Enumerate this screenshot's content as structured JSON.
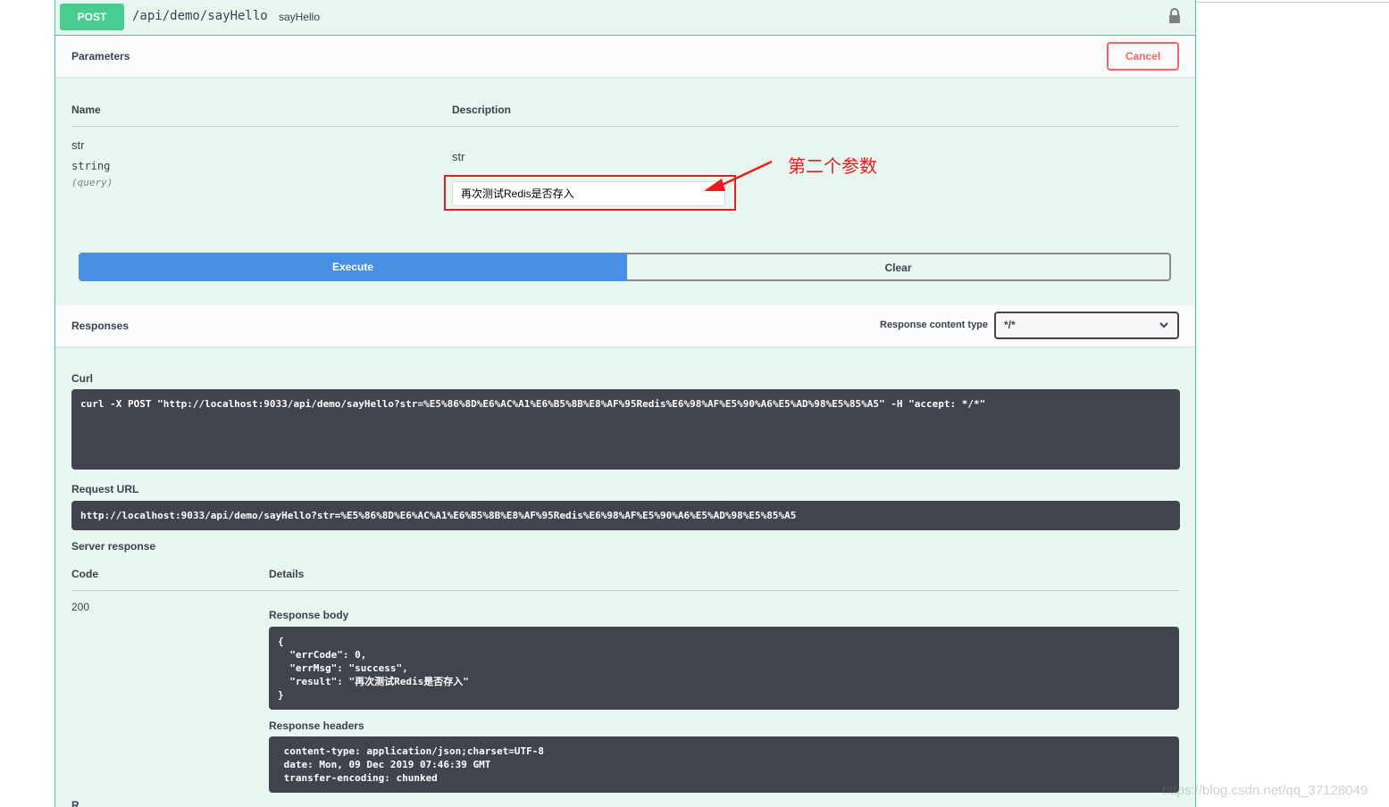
{
  "operation": {
    "method": "POST",
    "path": "/api/demo/sayHello",
    "summary": "sayHello",
    "lock_icon": "lock-icon"
  },
  "parameters": {
    "title": "Parameters",
    "cancel_label": "Cancel",
    "col_name": "Name",
    "col_description": "Description",
    "param": {
      "name": "str",
      "type": "string",
      "in": "(query)",
      "description": "str",
      "value": "再次测试Redis是否存入"
    },
    "annotation": "第二个参数",
    "execute_label": "Execute",
    "clear_label": "Clear"
  },
  "responses": {
    "title": "Responses",
    "content_type_label": "Response content type",
    "content_type_value": "*/*",
    "curl_label": "Curl",
    "curl": "curl -X POST \"http://localhost:9033/api/demo/sayHello?str=%E5%86%8D%E6%AC%A1%E6%B5%8B%E8%AF%95Redis%E6%98%AF%E5%90%A6%E5%AD%98%E5%85%A5\" -H \"accept: */*\"",
    "request_url_label": "Request URL",
    "request_url": "http://localhost:9033/api/demo/sayHello?str=%E5%86%8D%E6%AC%A1%E6%B5%8B%E8%AF%95Redis%E6%98%AF%E5%90%A6%E5%AD%98%E5%85%A5",
    "server_response_label": "Server response",
    "col_code": "Code",
    "col_details": "Details",
    "code": "200",
    "body_label": "Response body",
    "body": "{\n  \"errCode\": 0,\n  \"errMsg\": \"success\",\n  \"result\": \"再次测试Redis是否存入\"\n}",
    "headers_label": "Response headers",
    "headers": " content-type: application/json;charset=UTF-8\n date: Mon, 09 Dec 2019 07:46:39 GMT\n transfer-encoding: chunked",
    "next_label": "R"
  },
  "watermark": "https://blog.csdn.net/qq_37128049",
  "colors": {
    "post_green": "#49cc90",
    "execute_blue": "#4990e2",
    "cancel_red": "#ff6060",
    "annotation_red": "#e81c1c",
    "code_bg": "#41444e"
  }
}
